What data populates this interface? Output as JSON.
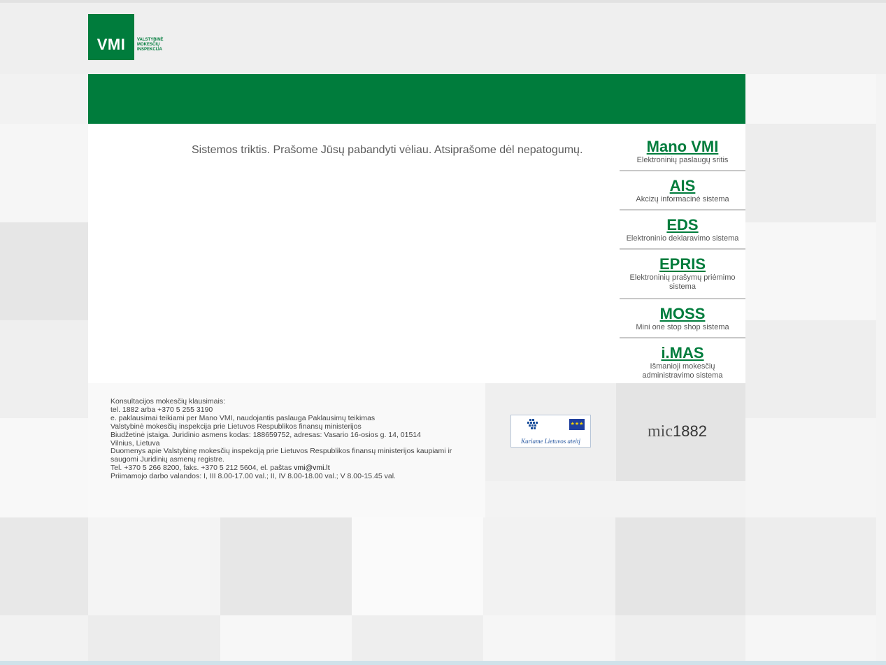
{
  "logo": {
    "mark": "VMI",
    "lines": [
      "VALSTYBINĖ",
      "MOKESČIŲ",
      "INSPEKCIJA"
    ]
  },
  "main": {
    "error_message": "Sistemos triktis. Prašome Jūsų pabandyti vėliau. Atsiprašome dėl nepatogumų."
  },
  "sidebar": {
    "links": [
      {
        "title": "Mano VMI",
        "desc": "Elektroninių paslaugų sritis"
      },
      {
        "title": "AIS",
        "desc": "Akcizų informacinė sistema"
      },
      {
        "title": "EDS",
        "desc": "Elektroninio deklaravimo sistema"
      },
      {
        "title": "EPRIS",
        "desc": "Elektroninių prašymų priėmimo sistema"
      },
      {
        "title": "MOSS",
        "desc": "Mini one stop shop sistema"
      },
      {
        "title": "i.MAS",
        "desc": "Išmanioji mokesčių administravimo sistema"
      }
    ]
  },
  "footer": {
    "lines": [
      "Konsultacijos mokesčių klausimais:",
      "tel. 1882 arba +370 5 255 3190",
      "e. paklausimai teikiami per Mano VMI, naudojantis paslauga Paklausimų teikimas",
      "Valstybinė mokesčių inspekcija prie Lietuvos Respublikos finansų ministerijos",
      "Biudžetinė įstaiga. Juridinio asmens kodas: 188659752, adresas: Vasario 16-osios g. 14, 01514 Vilnius, Lietuva",
      "Duomenys apie Valstybinę mokesčių inspekciją prie Lietuvos Respublikos finansų ministerijos kaupiami ir saugomi Juridinių asmenų registre.",
      "Priimamojo darbo valandos: I, III 8.00-17.00 val.; II, IV 8.00-18.00 val.; V 8.00-15.45 val."
    ],
    "contact_prefix": "Tel. +370 5 266 8200, faks. +370 5 212 5604, el. paštas ",
    "email": "vmi@vmi.lt"
  },
  "es_logo": {
    "caption": "Kuriame Lietuvos ateitį"
  },
  "mic_logo": {
    "mic": "mic",
    "number": "1882"
  },
  "colors": {
    "brand_green": "#007c3c",
    "link_green": "#007c3c"
  }
}
